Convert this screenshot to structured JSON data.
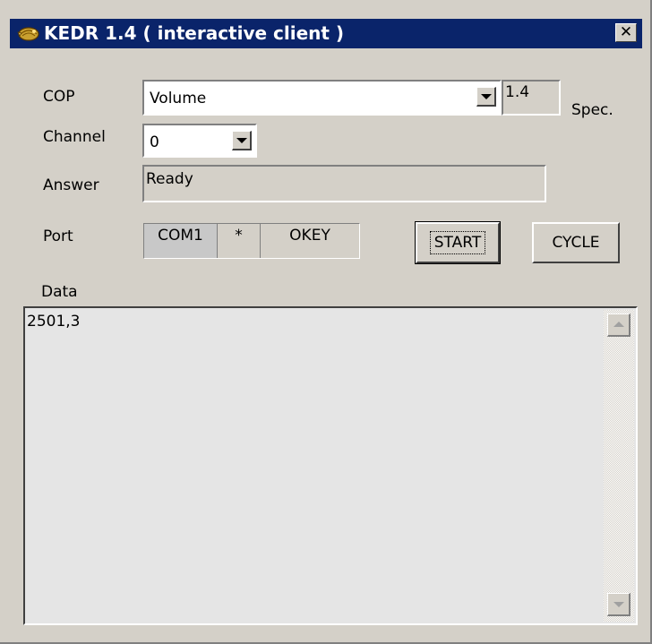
{
  "window": {
    "title": "KEDR 1.4 ( interactive client )",
    "close_glyph": "✕",
    "app_icon": "kedr-app-icon"
  },
  "colors": {
    "titlebar": "#0a246a",
    "face": "#d4d0c8",
    "data_bg": "#e5e5e5"
  },
  "form": {
    "cop_label": "COP",
    "cop_value": "Volume",
    "version_value": "1.4",
    "spec_label": "Spec.",
    "channel_label": "Channel",
    "channel_value": "0",
    "answer_label": "Answer",
    "answer_value": "Ready",
    "port_label": "Port",
    "port_name": "COM1",
    "port_indicator": "*",
    "port_status": "OKEY",
    "data_label": "Data"
  },
  "buttons": {
    "start_label": "START",
    "cycle_label": "CYCLE"
  },
  "data_area": {
    "content": "2501,3"
  }
}
